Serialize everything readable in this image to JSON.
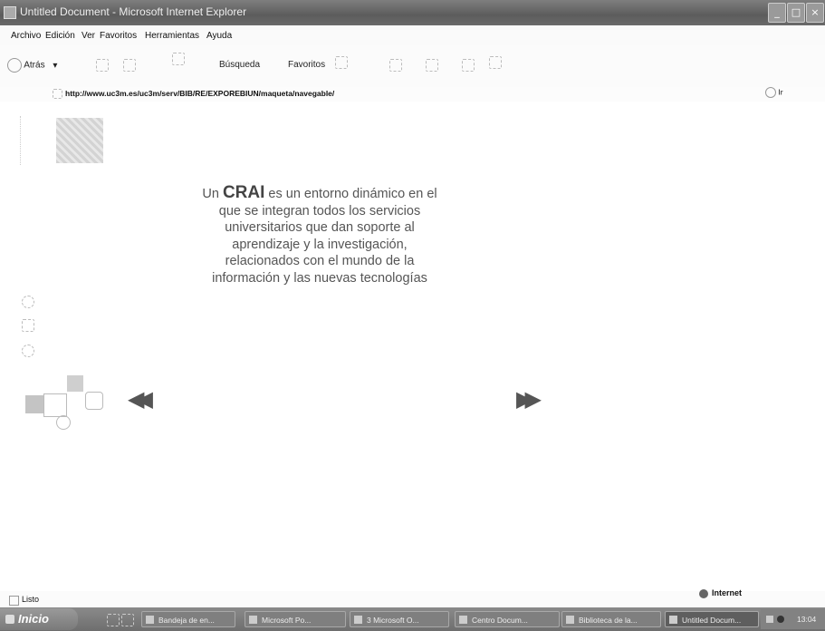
{
  "window": {
    "title": "Untitled Document - Microsoft Internet Explorer",
    "minimize": "_",
    "maximize": "□",
    "close": "×"
  },
  "menu": [
    "Archivo",
    "Edición",
    "Ver",
    "Favoritos",
    "Herramientas",
    "Ayuda"
  ],
  "toolbar": {
    "back_label": "Atrás",
    "back_arrow": "▾",
    "search_label": "Búsqueda",
    "favorites_label": "Favoritos"
  },
  "address": {
    "url": "http://www.uc3m.es/uc3m/serv/BIB/RE/EXPOREBIUN/maqueta/navegable/",
    "go_label": "Ir"
  },
  "content": {
    "crai_prefix": "Un",
    "crai_word": "CRAI",
    "crai_rest": "es un entorno dinámico en el que se integran todos los servicios universitarios que dan soporte al aprendizaje y la investigación, relacionados con el mundo de la información y las nuevas tecnologías",
    "prev_glyph": "◀◀",
    "next_glyph": "▶▶"
  },
  "status": {
    "text": "Listo",
    "zone": "Internet"
  },
  "taskbar": {
    "start": "Inicio",
    "items": [
      "Bandeja de en...",
      "Microsoft Po...",
      "3 Microsoft O...",
      "Centro Docum...",
      "Biblioteca de la...",
      "Untitled Docum..."
    ],
    "clock": "13:04"
  },
  "colors": {
    "titlebar": "#6e6e6e",
    "taskbar": "#7a7a7a",
    "text_gray": "#555555"
  }
}
